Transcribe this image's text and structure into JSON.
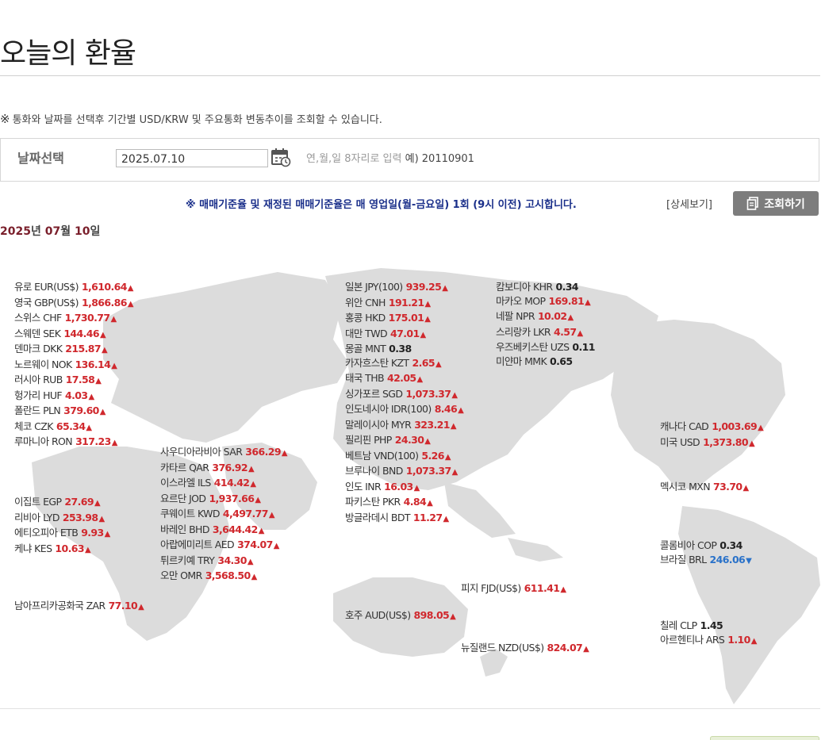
{
  "page": {
    "title": "오늘의 환율",
    "notice_mark": "※",
    "notice": "통화와 날짜를 선택후 기간별 USD/KRW 및 주요통화 변동추이를 조회할 수 있습니다."
  },
  "date_select": {
    "label": "날짜선택",
    "value": "2025.07.10",
    "hint": "연,월,일 8자리로 입력",
    "example": "예) 20110901"
  },
  "announcement": {
    "text": "※ 매매기준율 및 재정된 매매기준율은 매 영업일(월-금요일) 1회 (9시 이전) 고시합니다.",
    "detail_link": "[상세보기]",
    "query_button": "조회하기"
  },
  "date_heading": {
    "year": "2025",
    "year_unit": "년",
    "month": "07",
    "month_unit": "월",
    "day": "10",
    "day_unit": "일"
  },
  "groups": [
    {
      "id": "europe",
      "items": [
        {
          "name": "유로 EUR(US$)",
          "value": "1,610.64",
          "dir": "up"
        },
        {
          "name": "영국 GBP(US$)",
          "value": "1,866.86",
          "dir": "up"
        },
        {
          "name": "스위스 CHF",
          "value": "1,730.77",
          "dir": "up"
        },
        {
          "name": "스웨덴 SEK",
          "value": "144.46",
          "dir": "up"
        },
        {
          "name": "덴마크 DKK",
          "value": "215.87",
          "dir": "up"
        },
        {
          "name": "노르웨이 NOK",
          "value": "136.14",
          "dir": "up"
        },
        {
          "name": "러시아 RUB",
          "value": "17.58",
          "dir": "up"
        },
        {
          "name": "헝가리 HUF",
          "value": "4.03",
          "dir": "up"
        },
        {
          "name": "폴란드 PLN",
          "value": "379.60",
          "dir": "up"
        },
        {
          "name": "체코 CZK",
          "value": "65.34",
          "dir": "up"
        },
        {
          "name": "루마니아 RON",
          "value": "317.23",
          "dir": "up"
        }
      ]
    },
    {
      "id": "africa",
      "items": [
        {
          "name": "이집트 EGP",
          "value": "27.69",
          "dir": "up"
        },
        {
          "name": "리비아 LYD",
          "value": "253.98",
          "dir": "up"
        },
        {
          "name": "에티오피아 ETB",
          "value": "9.93",
          "dir": "up"
        },
        {
          "name": "케냐 KES",
          "value": "10.63",
          "dir": "up"
        }
      ]
    },
    {
      "id": "south-africa",
      "items": [
        {
          "name": "남아프리카공화국 ZAR",
          "value": "77.10",
          "dir": "up"
        }
      ]
    },
    {
      "id": "middle-east",
      "items": [
        {
          "name": "사우디아라비아 SAR",
          "value": "366.29",
          "dir": "up"
        },
        {
          "name": "카타르 QAR",
          "value": "376.92",
          "dir": "up"
        },
        {
          "name": "이스라엘 ILS",
          "value": "414.42",
          "dir": "up"
        },
        {
          "name": "요르단 JOD",
          "value": "1,937.66",
          "dir": "up"
        },
        {
          "name": "쿠웨이트 KWD",
          "value": "4,497.77",
          "dir": "up"
        },
        {
          "name": "바레인 BHD",
          "value": "3,644.42",
          "dir": "up"
        },
        {
          "name": "아랍에미리트 AED",
          "value": "374.07",
          "dir": "up"
        },
        {
          "name": "튀르키예 TRY",
          "value": "34.30",
          "dir": "up"
        },
        {
          "name": "오만 OMR",
          "value": "3,568.50",
          "dir": "up"
        }
      ]
    },
    {
      "id": "asia",
      "items": [
        {
          "name": "일본 JPY(100)",
          "value": "939.25",
          "dir": "up"
        },
        {
          "name": "위안 CNH",
          "value": "191.21",
          "dir": "up"
        },
        {
          "name": "홍콩 HKD",
          "value": "175.01",
          "dir": "up"
        },
        {
          "name": "대만 TWD",
          "value": "47.01",
          "dir": "up"
        },
        {
          "name": "몽골 MNT",
          "value": "0.38",
          "dir": "flat"
        },
        {
          "name": "카자흐스탄 KZT",
          "value": "2.65",
          "dir": "up"
        },
        {
          "name": "태국 THB",
          "value": "42.05",
          "dir": "up"
        },
        {
          "name": "싱가포르 SGD",
          "value": "1,073.37",
          "dir": "up"
        },
        {
          "name": "인도네시아 IDR(100)",
          "value": "8.46",
          "dir": "up"
        },
        {
          "name": "말레이시아 MYR",
          "value": "323.21",
          "dir": "up"
        },
        {
          "name": "필리핀 PHP",
          "value": "24.30",
          "dir": "up"
        },
        {
          "name": "베트남 VND(100)",
          "value": "5.26",
          "dir": "up"
        },
        {
          "name": "브루나이 BND",
          "value": "1,073.37",
          "dir": "up"
        },
        {
          "name": "인도 INR",
          "value": "16.03",
          "dir": "up"
        },
        {
          "name": "파키스탄 PKR",
          "value": "4.84",
          "dir": "up"
        },
        {
          "name": "방글라데시 BDT",
          "value": "11.27",
          "dir": "up"
        }
      ]
    },
    {
      "id": "asia-2",
      "items": [
        {
          "name": "캄보디아 KHR",
          "value": "0.34",
          "dir": "flat"
        },
        {
          "name": "마카오 MOP",
          "value": "169.81",
          "dir": "up"
        },
        {
          "name": "네팔 NPR",
          "value": "10.02",
          "dir": "up"
        },
        {
          "name": "스리랑카 LKR",
          "value": "4.57",
          "dir": "up"
        },
        {
          "name": "우즈베키스탄 UZS",
          "value": "0.11",
          "dir": "flat"
        },
        {
          "name": "미얀마 MMK",
          "value": "0.65",
          "dir": "flat"
        }
      ]
    },
    {
      "id": "oceania-fiji",
      "items": [
        {
          "name": "피지 FJD(US$)",
          "value": "611.41",
          "dir": "up"
        }
      ]
    },
    {
      "id": "oceania-au",
      "items": [
        {
          "name": "호주 AUD(US$)",
          "value": "898.05",
          "dir": "up"
        }
      ]
    },
    {
      "id": "oceania-nz",
      "items": [
        {
          "name": "뉴질랜드 NZD(US$)",
          "value": "824.07",
          "dir": "up"
        }
      ]
    },
    {
      "id": "north-america",
      "items": [
        {
          "name": "캐나다 CAD",
          "value": "1,003.69",
          "dir": "up"
        },
        {
          "name": "미국 USD",
          "value": "1,373.80",
          "dir": "up"
        }
      ]
    },
    {
      "id": "mexico",
      "items": [
        {
          "name": "멕시코 MXN",
          "value": "73.70",
          "dir": "up"
        }
      ]
    },
    {
      "id": "south-america-north",
      "items": [
        {
          "name": "콜롬비아 COP",
          "value": "0.34",
          "dir": "flat"
        },
        {
          "name": "브라질 BRL",
          "value": "246.06",
          "dir": "down"
        }
      ]
    },
    {
      "id": "south-america-south",
      "items": [
        {
          "name": "칠레 CLP",
          "value": "1.45",
          "dir": "flat"
        },
        {
          "name": "아르헨티나 ARS",
          "value": "1.10",
          "dir": "up"
        }
      ]
    }
  ],
  "colors": {
    "up": "#d0282d",
    "down": "#2a72c9",
    "announcement": "#1a2f8a",
    "map_land": "#dcdcdc"
  }
}
